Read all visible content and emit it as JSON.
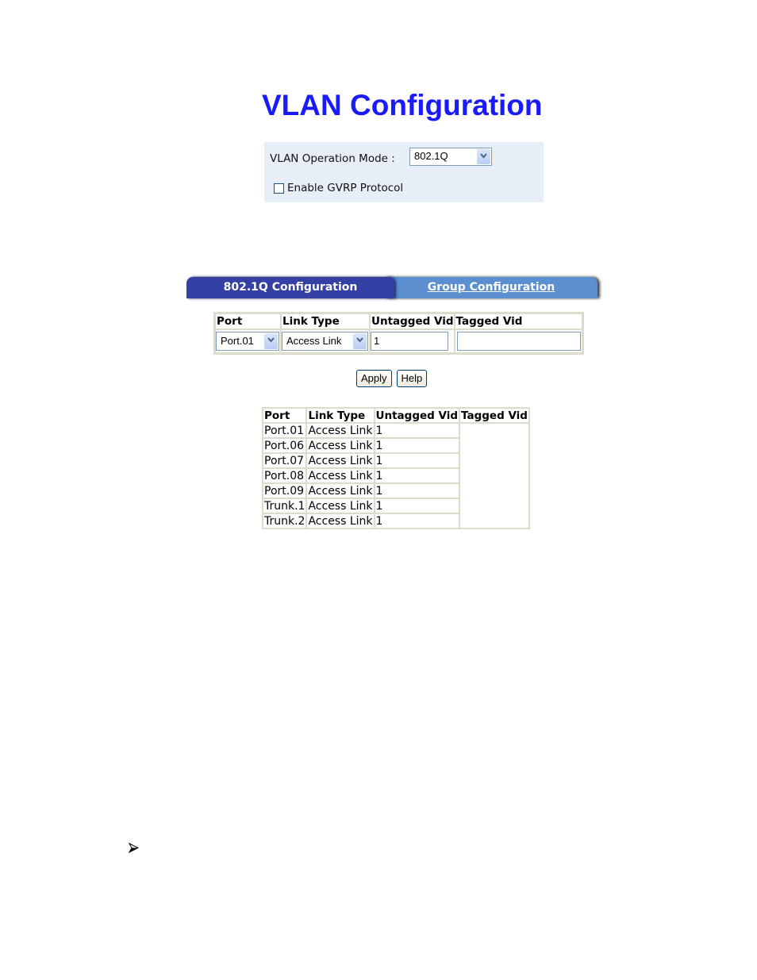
{
  "page": {
    "title": "VLAN Configuration"
  },
  "mode_panel": {
    "mode_label": "VLAN Operation Mode :",
    "mode_value": "802.1Q",
    "gvrp_label": "Enable GVRP Protocol",
    "gvrp_checked": false
  },
  "tabs": [
    {
      "label": "802.1Q Configuration",
      "active": true
    },
    {
      "label": "Group Configuration",
      "active": false
    }
  ],
  "config_table": {
    "headers": [
      "Port",
      "Link Type",
      "Untagged Vid",
      "Tagged Vid"
    ],
    "port_value": "Port.01",
    "link_type_value": "Access Link",
    "untagged_vid_value": "1",
    "tagged_vid_value": ""
  },
  "buttons": {
    "apply": "Apply",
    "help": "Help"
  },
  "status_table": {
    "headers": [
      "Port",
      "Link Type",
      "Untagged Vid",
      "Tagged Vid"
    ],
    "rows": [
      {
        "port": "Port.01",
        "link_type": "Access Link",
        "untagged_vid": "1"
      },
      {
        "port": "Port.06",
        "link_type": "Access Link",
        "untagged_vid": "1"
      },
      {
        "port": "Port.07",
        "link_type": "Access Link",
        "untagged_vid": "1"
      },
      {
        "port": "Port.08",
        "link_type": "Access Link",
        "untagged_vid": "1"
      },
      {
        "port": "Port.09",
        "link_type": "Access Link",
        "untagged_vid": "1"
      },
      {
        "port": "Trunk.1",
        "link_type": "Access Link",
        "untagged_vid": "1"
      },
      {
        "port": "Trunk.2",
        "link_type": "Access Link",
        "untagged_vid": "1"
      }
    ],
    "tagged_vid": ""
  },
  "colors": {
    "title": "#1a1aff",
    "panel_bg": "#e8eef7",
    "tab_active": "#3440a3",
    "tab_inactive": "#5b8fd0"
  },
  "icons": {
    "bullet": "arrowhead-bullet-icon",
    "dropdown": "chevron-down-icon"
  }
}
